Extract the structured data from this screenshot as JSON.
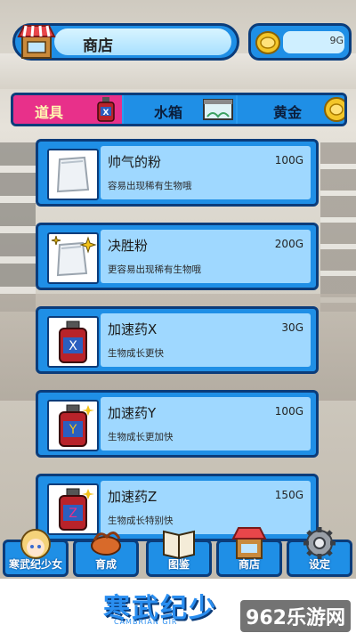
{
  "header": {
    "title": "商店",
    "gold": "9G"
  },
  "tabs": [
    {
      "label": "道具"
    },
    {
      "label": "水箱"
    },
    {
      "label": "黄金"
    }
  ],
  "items": [
    {
      "name": "帅气的粉",
      "price": "100G",
      "desc": "容易出现稀有生物哦"
    },
    {
      "name": "决胜粉",
      "price": "200G",
      "desc": "更容易出现稀有生物哦"
    },
    {
      "name": "加速药X",
      "price": "30G",
      "desc": "生物成长更快"
    },
    {
      "name": "加速药Y",
      "price": "100G",
      "desc": "生物成长更加快"
    },
    {
      "name": "加速药Z",
      "price": "150G",
      "desc": "生物成长特别快"
    }
  ],
  "nav": [
    {
      "label": "寒武纪少女"
    },
    {
      "label": "育成"
    },
    {
      "label": "图鉴"
    },
    {
      "label": "商店"
    },
    {
      "label": "设定"
    }
  ],
  "footer": {
    "logo": "寒武纪少",
    "logo_sub": "CAMBRIAN GIR",
    "watermark": "962乐游网"
  },
  "colors": {
    "panel": "#1f8fe6",
    "border": "#0b3c7a",
    "active_tab": "#e8308a"
  }
}
